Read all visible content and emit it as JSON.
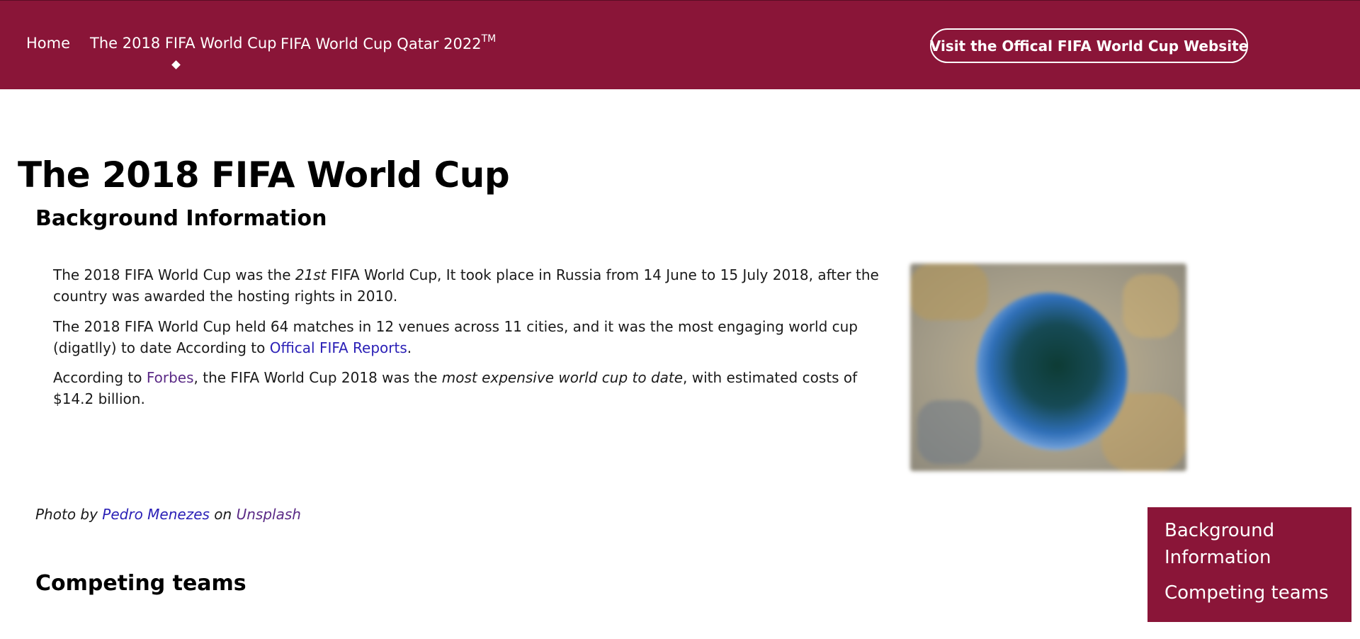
{
  "nav": {
    "home": "Home",
    "worldcup2018": "The 2018 FIFA World Cup",
    "qatar": "FIFA World Cup Qatar 2022",
    "qatar_sup": "TM",
    "visit_button": "Visit the Offical FIFA World Cup Website"
  },
  "colors": {
    "brand": "#8a1538",
    "link_blue": "#2a1fb6",
    "link_visited": "#5b2a86"
  },
  "page": {
    "title": "The 2018 FIFA World Cup",
    "background_heading": "Background Information",
    "paragraph1": {
      "a": "The 2018 FIFA World Cup was the ",
      "em": "21st",
      "b": " FIFA World Cup, It took place in Russia from 14 June to 15 July 2018, after the country was awarded the hosting rights in 2010."
    },
    "paragraph2": {
      "a": "The 2018 FIFA World Cup held 64 matches in 12 venues across 11 cities, and it was the most engaging world cup (digatlly) to date According to ",
      "link": "Offical FIFA Reports",
      "b": "."
    },
    "paragraph3": {
      "a": "According to ",
      "link": "Forbes",
      "b": ", the FIFA World Cup 2018 was the ",
      "em": "most expensive world cup to date",
      "c": ", with estimated costs of $14.2 billion."
    },
    "photo_credit": {
      "prefix": "Photo by ",
      "author": "Pedro Menezes",
      "middle": " on ",
      "site": "Unsplash"
    },
    "teams_heading": "Competing teams"
  },
  "toc": {
    "items": [
      "Background Information",
      "Competing teams"
    ]
  }
}
